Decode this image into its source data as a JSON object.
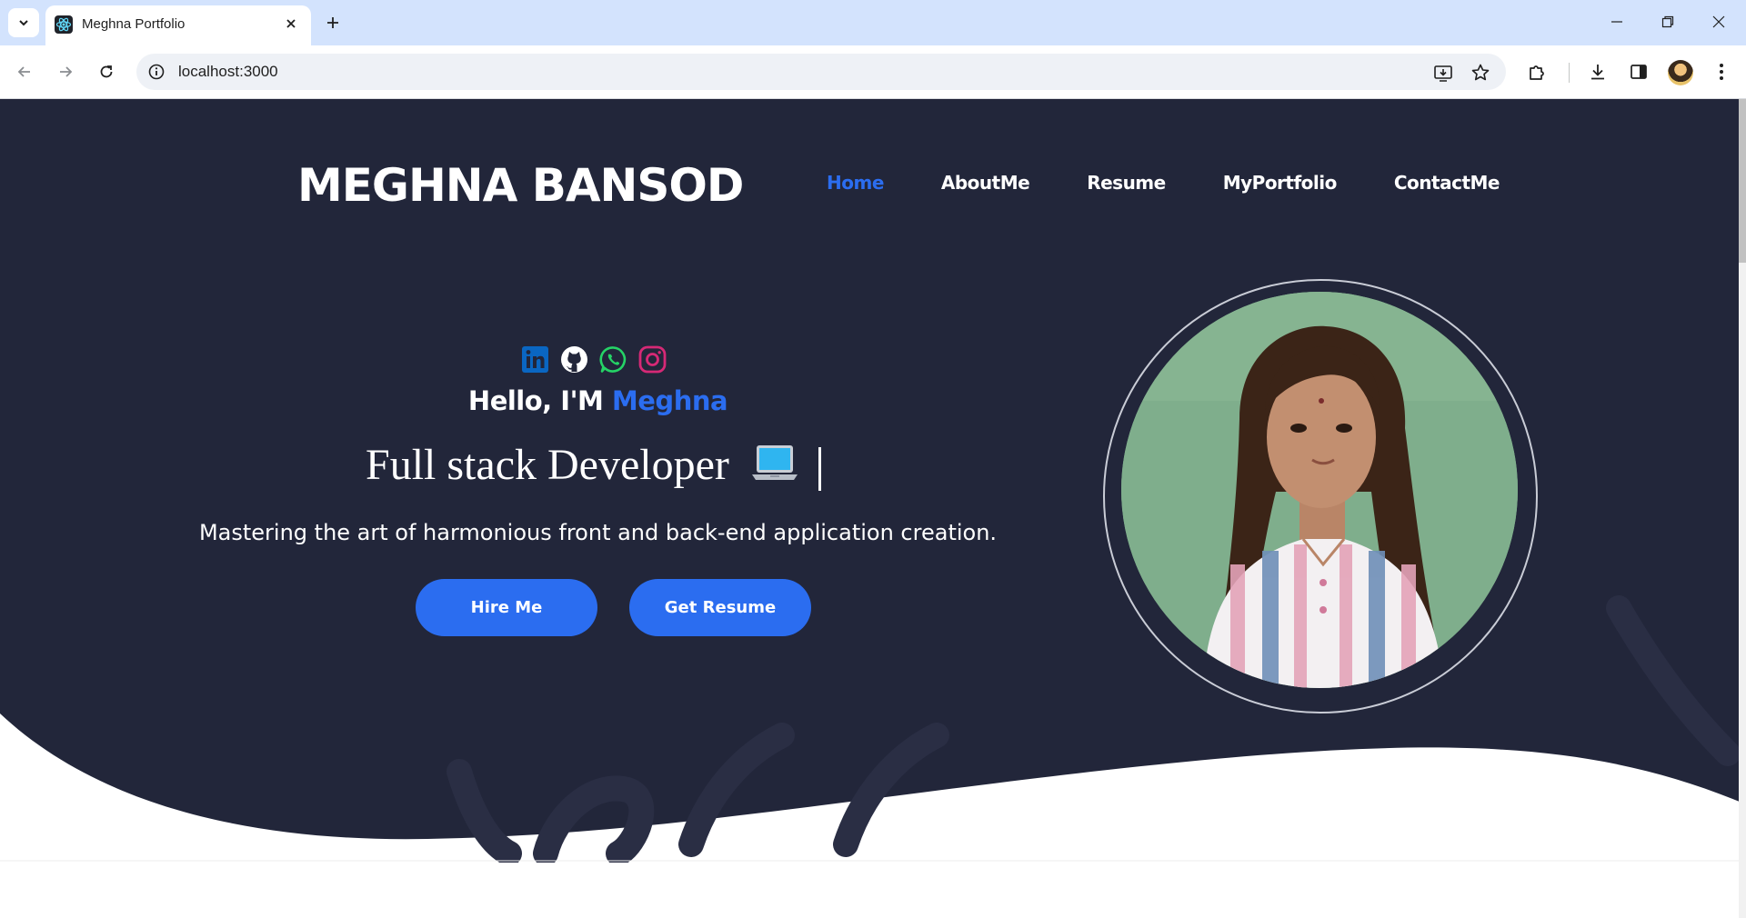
{
  "browser": {
    "tab_title": "Meghna Portfolio",
    "url": "localhost:3000"
  },
  "site": {
    "brand": "MEGHNA BANSOD",
    "nav": [
      {
        "label": "Home",
        "active": true
      },
      {
        "label": "AboutMe",
        "active": false
      },
      {
        "label": "Resume",
        "active": false
      },
      {
        "label": "MyPortfolio",
        "active": false
      },
      {
        "label": "ContactMe",
        "active": false
      }
    ],
    "social_icons": [
      "linkedin-icon",
      "github-icon",
      "whatsapp-icon",
      "instagram-icon"
    ],
    "hero": {
      "greeting": "Hello, I'M ",
      "name": "Meghna",
      "headline": "Full stack Developer",
      "tagline": "Mastering the art of harmonious front and back-end application creation.",
      "hire_button": "Hire Me",
      "resume_button": "Get Resume"
    }
  },
  "colors": {
    "hero_background": "#22263a",
    "accent": "#2b6df0",
    "tabbar": "#d3e3fd"
  }
}
